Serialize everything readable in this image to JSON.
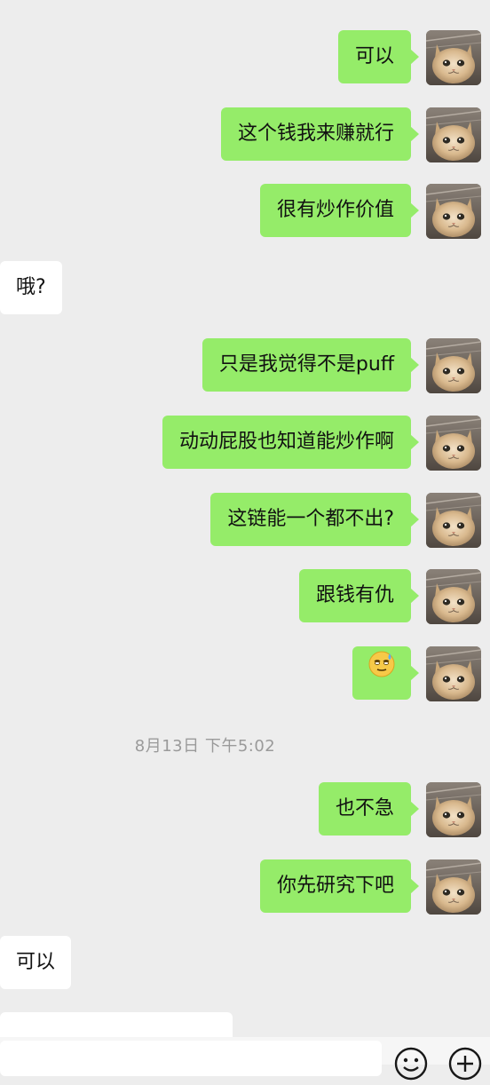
{
  "messages": [
    {
      "dir": "out",
      "text": "可以"
    },
    {
      "dir": "out",
      "text": "这个钱我来赚就行"
    },
    {
      "dir": "out",
      "text": "很有炒作价值"
    },
    {
      "dir": "in",
      "text": "哦?"
    },
    {
      "dir": "out",
      "text": "只是我觉得不是puff"
    },
    {
      "dir": "out",
      "text": "动动屁股也知道能炒作啊"
    },
    {
      "dir": "out",
      "text": "这链能一个都不出?"
    },
    {
      "dir": "out",
      "text": "跟钱有仇"
    },
    {
      "dir": "out",
      "emoji": "sweat-smile-emoji"
    },
    {
      "dir": "out",
      "text": "也不急"
    },
    {
      "dir": "out",
      "text": "你先研究下吧"
    },
    {
      "dir": "in",
      "text": "可以"
    }
  ],
  "timestamp": "8月13日 下午5:02",
  "input_bar": {
    "emoji_icon": "smiley-face-icon",
    "plus_icon": "plus-circle-icon"
  },
  "colors": {
    "background": "#ededed",
    "outgoing_bubble": "#95ec69",
    "incoming_bubble": "#ffffff",
    "timestamp_text": "#9a9a9a"
  }
}
